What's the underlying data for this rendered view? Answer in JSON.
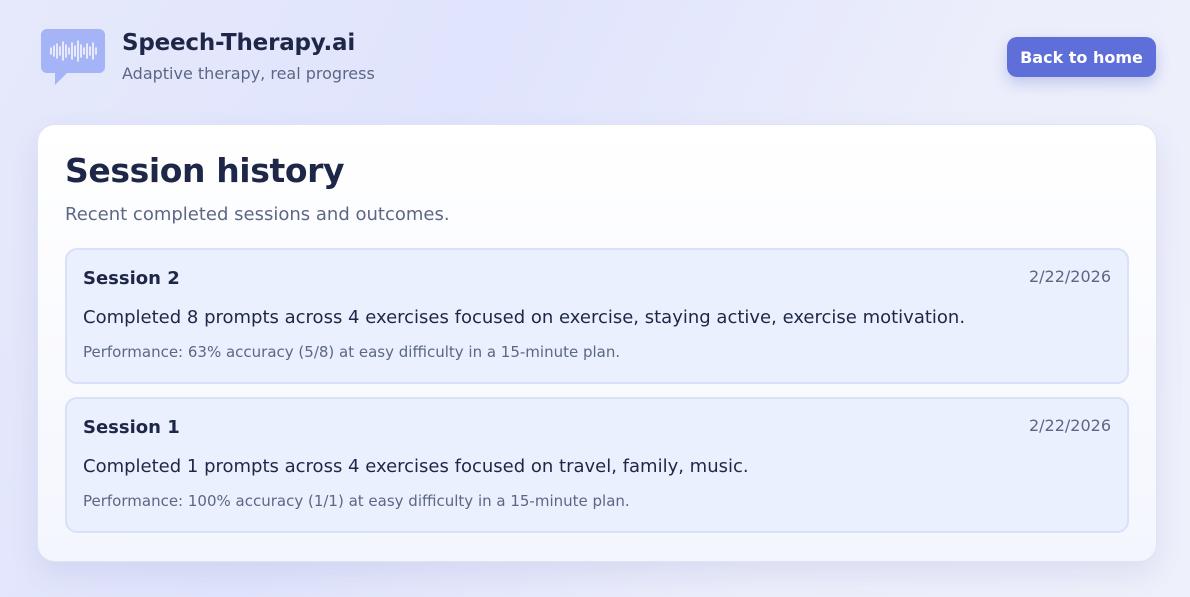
{
  "brand": {
    "title": "Speech-Therapy.ai",
    "subtitle": "Adaptive therapy, real progress",
    "logo_icon": "speech-bubble-waveform-icon",
    "logo_color": "#a4b4f6"
  },
  "header": {
    "back_label": "Back to home",
    "accent": "#5f6fd9"
  },
  "history": {
    "title": "Session history",
    "subtitle": "Recent completed sessions and outcomes.",
    "sessions": [
      {
        "title": "Session 2",
        "date": "2/22/2026",
        "summary": "Completed 8 prompts across 4 exercises focused on exercise, staying active, exercise motivation.",
        "performance": "Performance: 63% accuracy (5/8) at easy difficulty in a 15-minute plan."
      },
      {
        "title": "Session 1",
        "date": "2/22/2026",
        "summary": "Completed 1 prompts across 4 exercises focused on travel, family, music.",
        "performance": "Performance: 100% accuracy (1/1) at easy difficulty in a 15-minute plan."
      }
    ]
  }
}
